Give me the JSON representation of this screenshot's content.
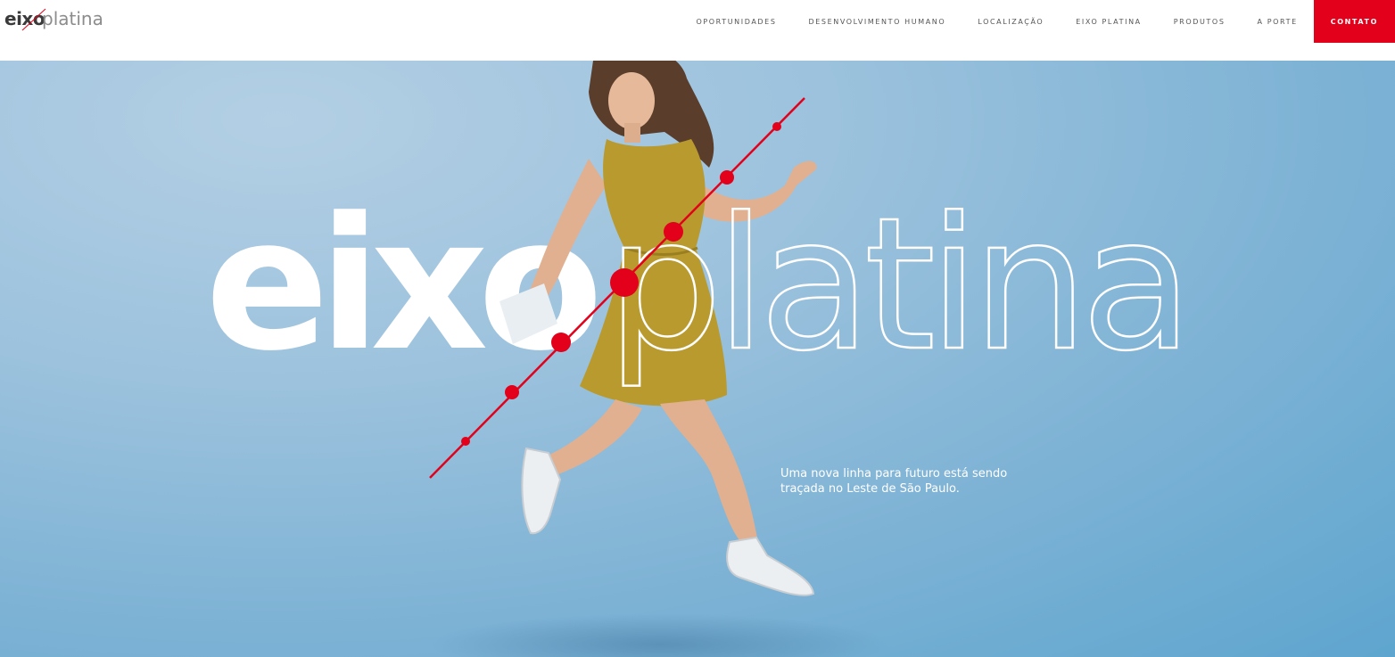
{
  "logo": {
    "bold": "eixo",
    "light": "platina"
  },
  "nav": {
    "items": [
      "OPORTUNIDADES",
      "DESENVOLVIMENTO HUMANO",
      "LOCALIZAÇÃO",
      "EIXO PLATINA",
      "PRODUTOS",
      "A PORTE"
    ],
    "contact": "CONTATO"
  },
  "hero": {
    "title_bold": "eixo",
    "title_light": "platina",
    "tagline": "Uma nova linha para futuro está sendo traçada no Leste de São Paulo."
  },
  "colors": {
    "accent": "#e3001b",
    "hero_background": "#8fbcdc",
    "text_white": "#ffffff",
    "dress": "#b99a2e"
  }
}
